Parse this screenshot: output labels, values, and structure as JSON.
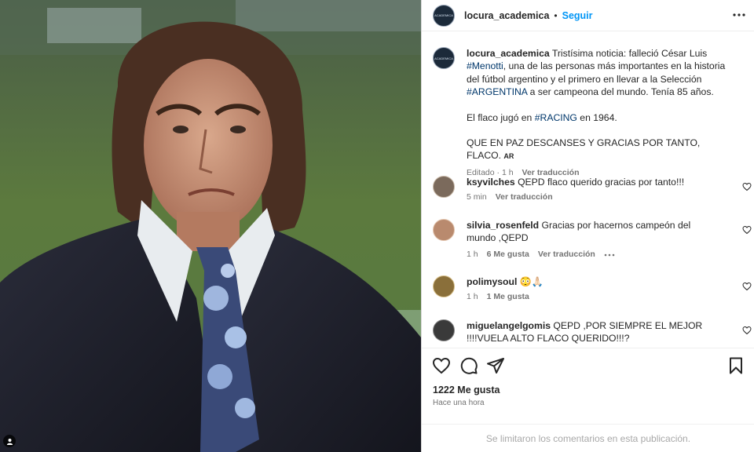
{
  "post": {
    "username": "locura_academica",
    "follow_label": "Seguir",
    "avatar_text": "ACADEMICA"
  },
  "caption": {
    "username": "locura_academica",
    "text_1": "Tristísima noticia: falleció César Luis ",
    "hashtag_menotti": "#Menotti",
    "text_2": ", una de las personas más importantes en la historia del fútbol argentino y el primero en llevar a la Selección ",
    "hashtag_argentina": "#ARGENTINA",
    "text_3": " a ser campeona del mundo. Tenía 85 años.",
    "line2_a": "El flaco jugó en ",
    "hashtag_racing": "#RACING",
    "line2_b": " en 1964.",
    "line3": "QUE EN PAZ DESCANSES Y GRACIAS POR TANTO, FLACO.",
    "country_tag": "AR",
    "edited": "Editado · 1 h",
    "translate": "Ver traducción"
  },
  "comments": [
    {
      "username": "ksyvilches",
      "text": "QEPD flaco querido gracias por tanto!!!",
      "time": "5 min",
      "likes": "",
      "translate": "Ver traducción"
    },
    {
      "username": "silvia_rosenfeld",
      "text": "Gracias por hacernos campeón del mundo ,QEPD",
      "time": "1 h",
      "likes": "6 Me gusta",
      "translate": "Ver traducción"
    },
    {
      "username": "polimysoul",
      "text": "😳🙏🏻",
      "time": "1 h",
      "likes": "1 Me gusta",
      "translate": ""
    },
    {
      "username": "miguelangelgomis",
      "text": "QEPD ,POR SIEMPRE EL MEJOR !!!!VUELA ALTO FLACO QUERIDO!!!?",
      "time": "",
      "likes": "",
      "translate": ""
    }
  ],
  "footer": {
    "likes": "1222 Me gusta",
    "time_ago": "Hace una hora",
    "comments_limited": "Se limitaron los comentarios en esta publicación."
  },
  "icons": [
    "more-options-icon",
    "heart-icon",
    "comment-icon",
    "share-icon",
    "save-icon",
    "tag-user-icon"
  ],
  "colors": {
    "link": "#0095f6",
    "hashtag": "#00376b",
    "muted": "#737373",
    "text": "#262626"
  }
}
